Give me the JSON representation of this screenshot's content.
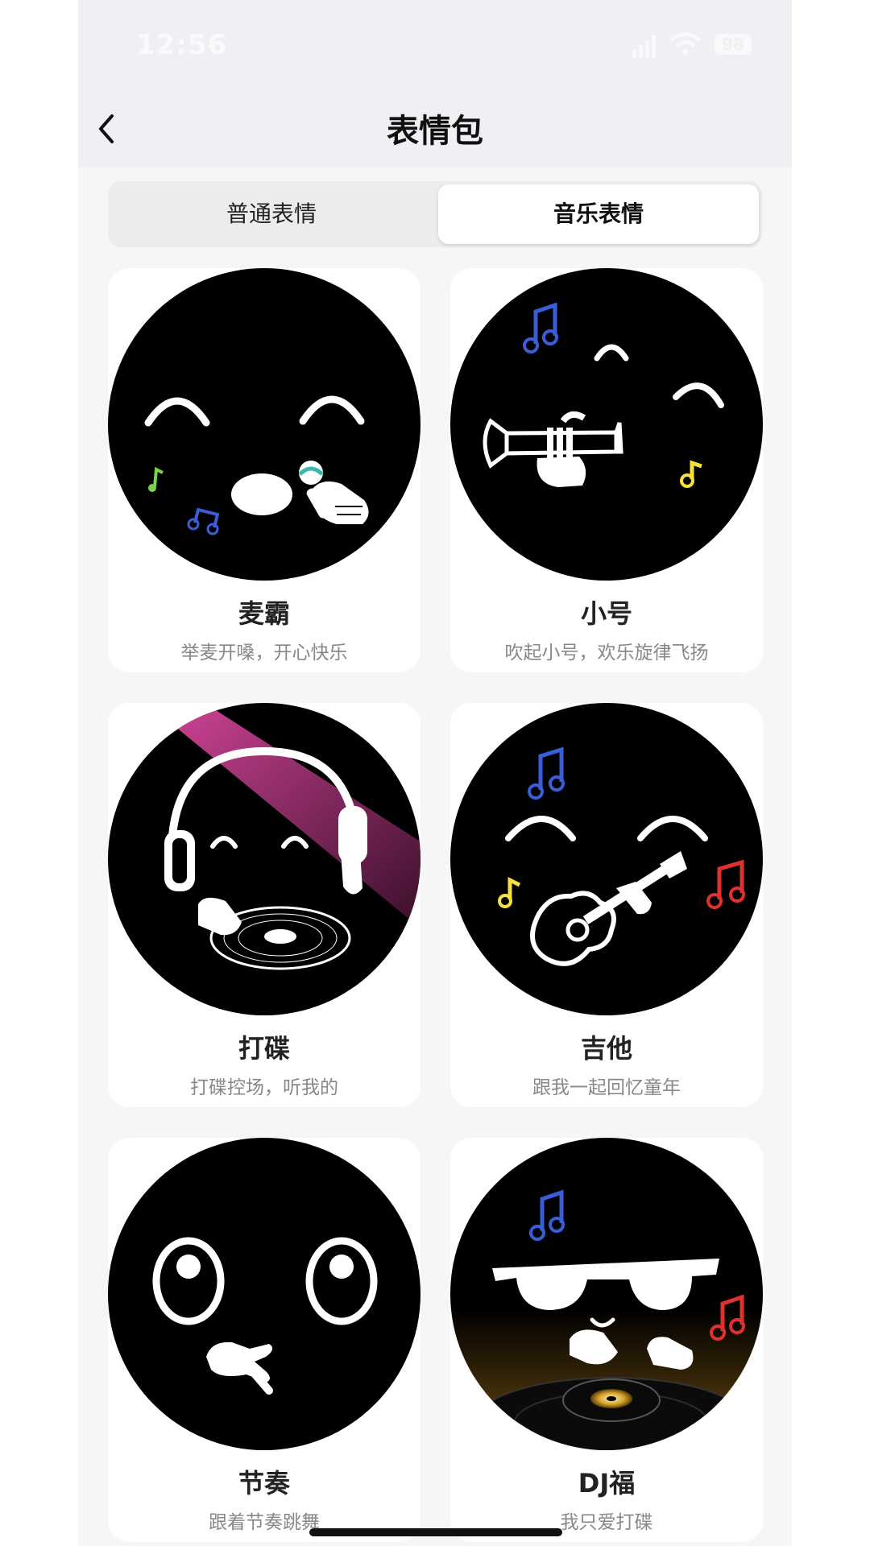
{
  "status": {
    "time": "12:56",
    "battery": "98"
  },
  "header": {
    "title": "表情包"
  },
  "tabs": [
    {
      "label": "普通表情",
      "selected": false
    },
    {
      "label": "音乐表情",
      "selected": true
    }
  ],
  "stickers": [
    {
      "name": "麦霸",
      "desc": "举麦开嗓，开心快乐"
    },
    {
      "name": "小号",
      "desc": "吹起小号，欢乐旋律飞扬"
    },
    {
      "name": "打碟",
      "desc": "打碟控场，听我的"
    },
    {
      "name": "吉他",
      "desc": "跟我一起回忆童年"
    },
    {
      "name": "节奏",
      "desc": "跟着节奏跳舞"
    },
    {
      "name": "DJ福",
      "desc": "我只爱打碟"
    }
  ],
  "colors": {
    "note_blue": "#3a5ed8",
    "note_yellow": "#f5e13a",
    "note_red": "#e0302f",
    "note_green": "#7bd34a",
    "spotlight": "#e94ca8"
  }
}
